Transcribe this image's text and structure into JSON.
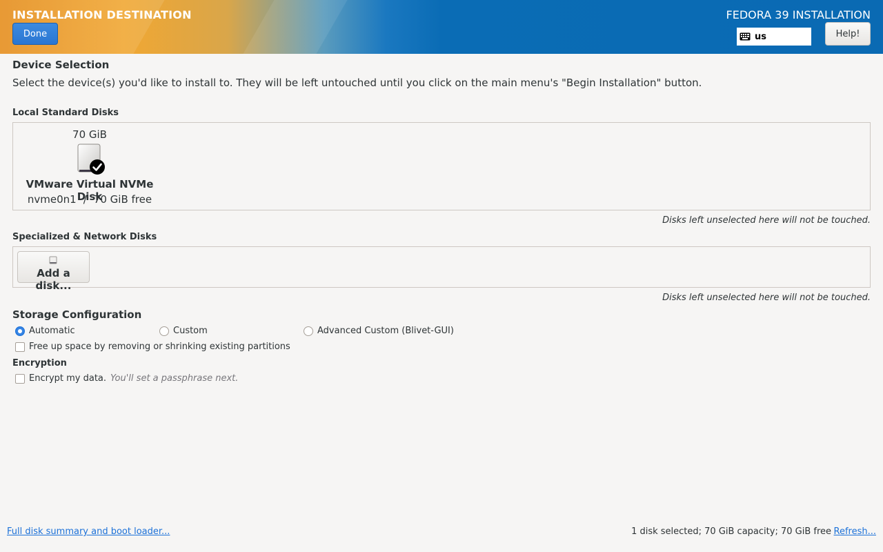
{
  "header": {
    "title": "INSTALLATION DESTINATION",
    "done_label": "Done",
    "product": "FEDORA 39 INSTALLATION",
    "keyboard_layout": "us",
    "help_label": "Help!"
  },
  "device_selection": {
    "heading": "Device Selection",
    "description": "Select the device(s) you'd like to install to.  They will be left untouched until you click on the main menu's \"Begin Installation\" button."
  },
  "local_disks": {
    "heading": "Local Standard Disks",
    "disks": [
      {
        "size": "70 GiB",
        "name": "VMware Virtual NVMe Disk",
        "device": "nvme0n1",
        "separator": "/",
        "free": "70 GiB free",
        "selected": true
      }
    ],
    "hint": "Disks left unselected here will not be touched."
  },
  "network_disks": {
    "heading": "Specialized & Network Disks",
    "add_label": "Add a disk...",
    "hint": "Disks left unselected here will not be touched."
  },
  "storage_config": {
    "heading": "Storage Configuration",
    "options": [
      {
        "label": "Automatic",
        "selected": true
      },
      {
        "label": "Custom",
        "selected": false
      },
      {
        "label": "Advanced Custom (Blivet-GUI)",
        "selected": false
      }
    ],
    "free_space_label": "Free up space by removing or shrinking existing partitions"
  },
  "encryption": {
    "heading": "Encryption",
    "encrypt_label": "Encrypt my data.",
    "encrypt_note": "You'll set a passphrase next."
  },
  "footer": {
    "summary_link": "Full disk summary and boot loader...",
    "status": "1 disk selected; 70 GiB capacity; 70 GiB free",
    "refresh_link": "Refresh..."
  },
  "colors": {
    "accent": "#3584e4",
    "header_blue": "#0a6ab3",
    "header_orange": "#f0a733"
  }
}
